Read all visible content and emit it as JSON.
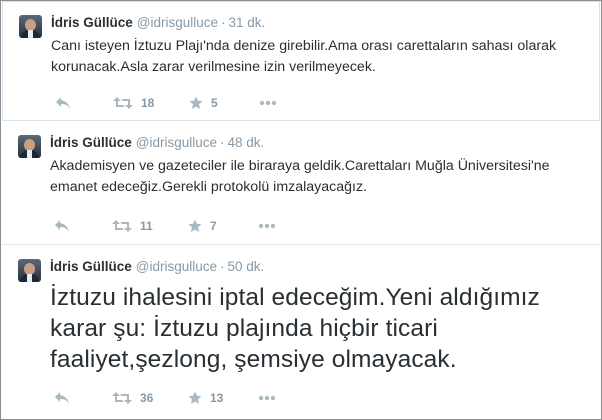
{
  "tweets": [
    {
      "name": "İdris Güllüce",
      "handle": "@idrisgulluce",
      "separator": "·",
      "time": "31 dk.",
      "text": "Canı isteyen İztuzu Plajı'nda denize girebilir.Ama orası carettaların sahası olarak korunacak.Asla zarar verilmesine izin verilmeyecek.",
      "retweets": "18",
      "favorites": "5"
    },
    {
      "name": "İdris Güllüce",
      "handle": "@idrisgulluce",
      "separator": "·",
      "time": "48 dk.",
      "text": "Akademisyen ve gazeteciler ile biraraya geldik.Carettaları Muğla Üniversitesi'ne emanet edeceğiz.Gerekli protokolü imzalayacağız.",
      "retweets": "11",
      "favorites": "7"
    },
    {
      "name": "İdris Güllüce",
      "handle": "@idrisgulluce",
      "separator": "·",
      "time": "50 dk.",
      "text": "İztuzu ihalesini iptal edeceğim.Yeni aldığımız karar şu: İztuzu plajında hiçbir ticari faaliyet,şezlong, şemsiye olmayacak.",
      "retweets": "36",
      "favorites": "13"
    }
  ],
  "icons": {
    "reply": "reply-icon",
    "retweet": "retweet-icon",
    "favorite": "star-icon",
    "more": "more-dots-icon"
  },
  "colors": {
    "name": "#292f33",
    "meta": "#8899a6",
    "icon": "#aab8c2",
    "divider": "#e1e8ed"
  }
}
